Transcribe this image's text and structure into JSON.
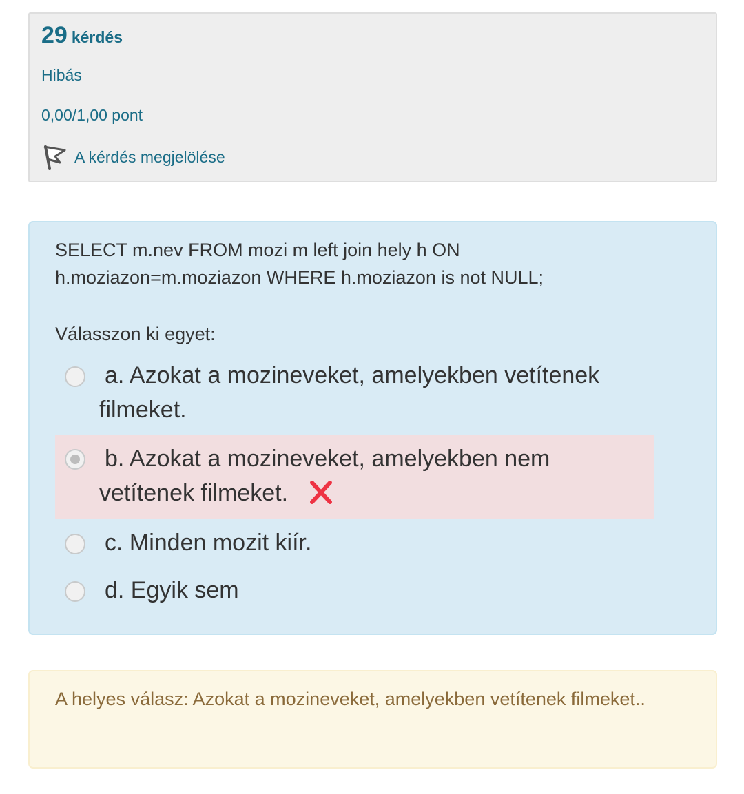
{
  "info": {
    "question_number": "29",
    "question_word": "kérdés",
    "state": "Hibás",
    "grade": "0,00/1,00 pont",
    "flag_label": "A kérdés megjelölése"
  },
  "question": {
    "text": "SELECT m.nev FROM mozi m left join hely h ON h.moziazon=m.moziazon WHERE h.moziazon is not NULL;",
    "prompt": "Válasszon ki egyet:",
    "answers": [
      {
        "label": "a. Azokat a mozineveket, amelyekben vetítenek filmeket.",
        "selected": false,
        "marked": "none"
      },
      {
        "label": "b. Azokat a mozineveket, amelyekben nem vetítenek filmeket.",
        "selected": true,
        "marked": "incorrect"
      },
      {
        "label": "c. Minden mozit kiír.",
        "selected": false,
        "marked": "none"
      },
      {
        "label": "d. Egyik sem",
        "selected": false,
        "marked": "none"
      }
    ]
  },
  "feedback": {
    "right_answer": "A helyes válasz: Azokat a mozineveket, amelyekben vetítenek filmeket.."
  },
  "colors": {
    "link": "#1a6d87",
    "question_bg": "#d9ebf5",
    "incorrect_bg": "#f2dee0",
    "feedback_text": "#8a6a3a",
    "incorrect_icon": "#ee3344"
  },
  "icons": {
    "flag": "flag-icon",
    "incorrect": "red-cross-icon"
  }
}
